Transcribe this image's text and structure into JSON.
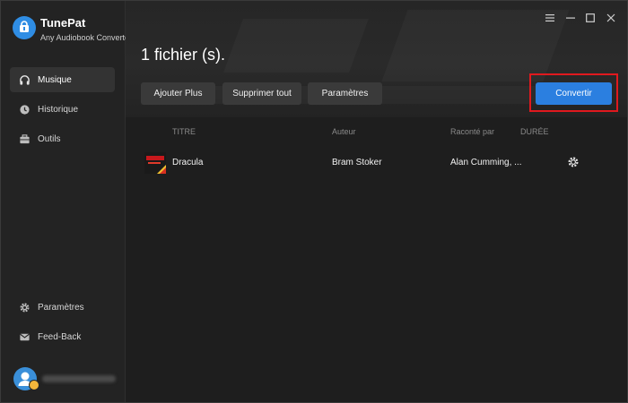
{
  "app": {
    "name": "TunePat",
    "subtitle": "Any Audiobook Converter"
  },
  "sidebar": {
    "items": [
      {
        "label": "Musique",
        "icon": "headphones-icon",
        "active": true
      },
      {
        "label": "Historique",
        "icon": "clock-icon",
        "active": false
      },
      {
        "label": "Outils",
        "icon": "toolbox-icon",
        "active": false
      }
    ],
    "bottom": [
      {
        "label": "Paramètres",
        "icon": "gear-icon"
      },
      {
        "label": "Feed-Back",
        "icon": "mail-icon"
      }
    ]
  },
  "window_controls": [
    "menu-icon",
    "minimize-icon",
    "maximize-icon",
    "close-icon"
  ],
  "main": {
    "file_count": "1 fichier (s).",
    "buttons": {
      "add": "Ajouter Plus",
      "delete_all": "Supprimer tout",
      "settings": "Paramètres",
      "convert": "Convertir"
    },
    "columns": {
      "title": "TITRE",
      "author": "Auteur",
      "narrator": "Raconté par",
      "duration": "DURÉE"
    },
    "rows": [
      {
        "title": "Dracula",
        "author": "Bram Stoker",
        "narrator": "Alan Cumming, ...",
        "duration": ""
      }
    ]
  },
  "colors": {
    "accent": "#2b7fe0",
    "highlight_frame": "#e0191e",
    "background": "#1e1e1e",
    "sidebar": "#232323"
  }
}
